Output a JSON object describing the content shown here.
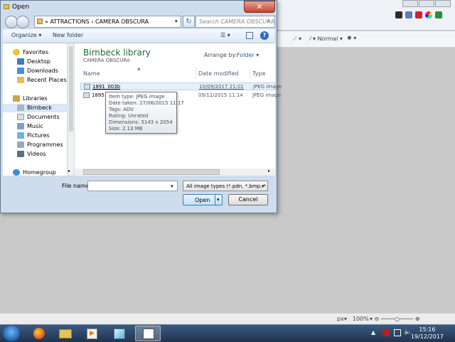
{
  "background_app": {
    "ribbon": {
      "style_label": "Normal"
    },
    "statusbar": {
      "unit": "px",
      "zoom": "100%"
    }
  },
  "taskbar": {
    "clock_time": "15:16",
    "clock_date": "19/12/2017"
  },
  "dialog": {
    "title": "Open",
    "close_glyph": "✕",
    "address_path": "«  ATTRACTIONS  ›  CAMERA OBSCURA",
    "search_placeholder": "Search CAMERA OBSCURA",
    "toolbar": {
      "organize": "Organize ▾",
      "new_folder": "New folder"
    },
    "nav": {
      "favorites": "Favorites",
      "items_fav": [
        "Desktop",
        "Downloads",
        "Recent Places"
      ],
      "libraries": "Libraries",
      "items_lib": [
        "Birnbeck",
        "Documents",
        "Music",
        "Pictures",
        "Programmes",
        "Videos"
      ],
      "homegroup": "Homegroup"
    },
    "library": {
      "title": "Birnbeck library",
      "subtitle": "CAMERA OBSCURA",
      "arrange_label": "Arrange by:",
      "arrange_value": "Folder ▾"
    },
    "columns": {
      "name": "Name",
      "date": "Date modified",
      "type": "Type"
    },
    "files": [
      {
        "name": "1891_003b",
        "date": "10/09/2017 21:01",
        "type": "JPEG image"
      },
      {
        "name": "1895",
        "date": "09/12/2015 11:14",
        "type": "JPEG image"
      }
    ],
    "tooltip": [
      "Item type: JPEG image",
      "Date taken: 27/06/2015 11:17",
      "Tags: ADV",
      "Rating: Unrated",
      "Dimensions: 5143 x 2054",
      "Size: 2.13 MB"
    ],
    "filename_label": "File name:",
    "filename_value": "",
    "filetype_value": "All image types (*.pdn, *.bmp, *",
    "open_label": "Open",
    "cancel_label": "Cancel"
  }
}
